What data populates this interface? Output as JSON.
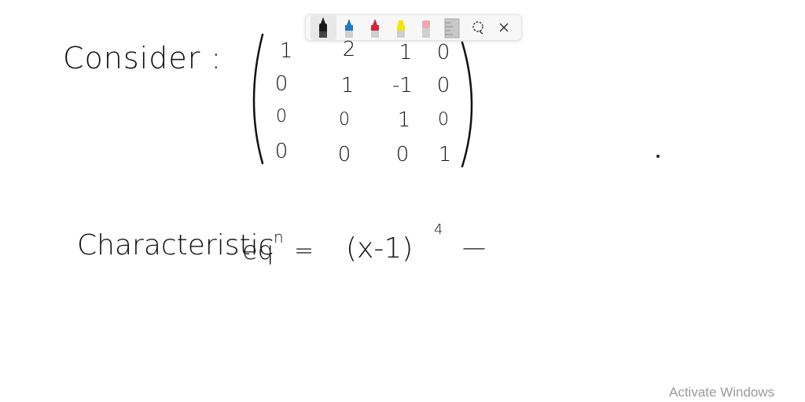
{
  "toolbar": {
    "tools": [
      {
        "name": "ballpoint-pen",
        "color": "#1a1a1a",
        "active": true
      },
      {
        "name": "pen-blue",
        "color": "#1e78c8",
        "active": false
      },
      {
        "name": "pen-red",
        "color": "#d6253a",
        "active": false
      },
      {
        "name": "highlighter-yellow",
        "color": "#f2e600",
        "active": false
      },
      {
        "name": "eraser",
        "color": "#f0a8b0",
        "active": false
      },
      {
        "name": "ruler",
        "color": "#b8b8b8",
        "active": false
      },
      {
        "name": "lasso-select",
        "color": "#333333",
        "active": false
      },
      {
        "name": "close",
        "color": "#333333",
        "active": false
      }
    ]
  },
  "notes": {
    "consider": "Consider :",
    "matrix": [
      [
        "1",
        "2",
        "1",
        "0"
      ],
      [
        "0",
        "1",
        "-1",
        "0"
      ],
      [
        "0",
        "0",
        "1",
        "0"
      ],
      [
        "0",
        "0",
        "0",
        "1"
      ]
    ],
    "char_label": "Characteristic",
    "eqn_label": "eq",
    "eqn_sup": "n",
    "equals": "=",
    "expression": "(x-1)",
    "exponent": "4",
    "dash": "—"
  },
  "watermark": "Activate Windows"
}
